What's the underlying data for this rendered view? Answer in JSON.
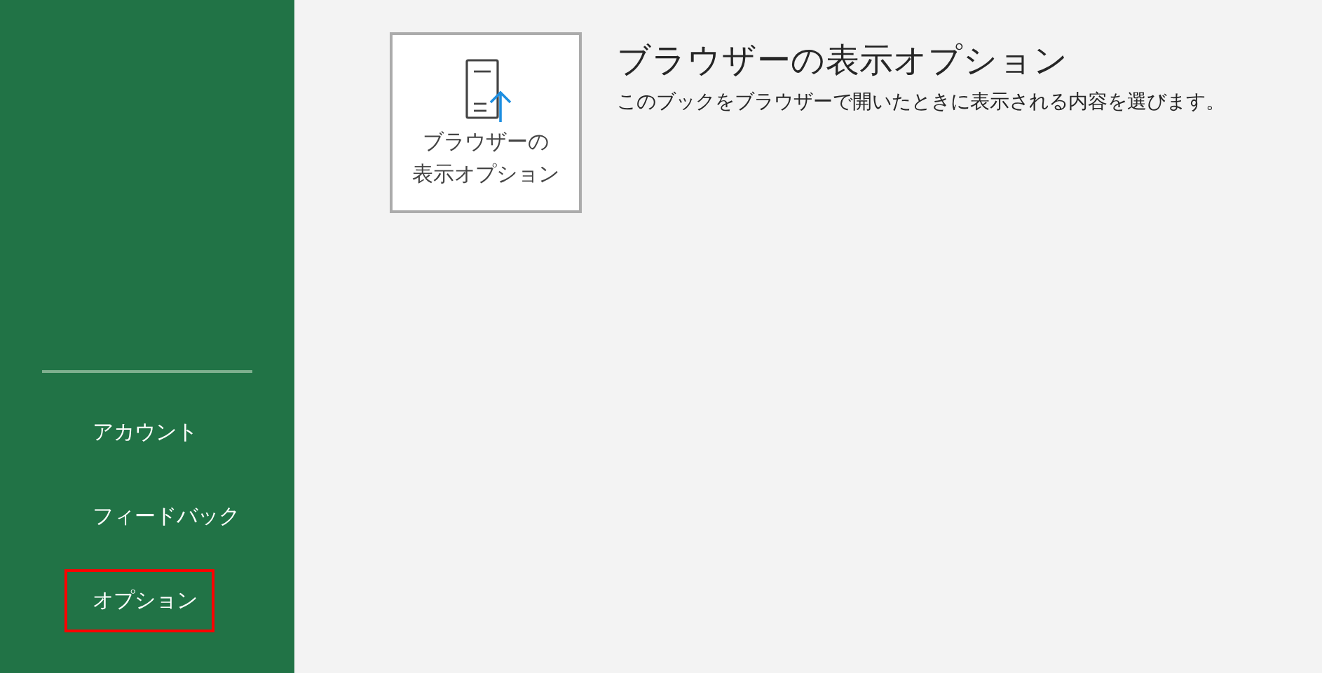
{
  "sidebar": {
    "items": [
      {
        "label": "アカウント",
        "highlighted": false
      },
      {
        "label": "フィードバック",
        "highlighted": false
      },
      {
        "label": "オプション",
        "highlighted": true
      }
    ]
  },
  "browser_view_options": {
    "button_lines": [
      "ブラウザーの",
      "表示オプション"
    ],
    "title": "ブラウザーの表示オプション",
    "description": "このブックをブラウザーで開いたときに表示される内容を選びます。"
  }
}
